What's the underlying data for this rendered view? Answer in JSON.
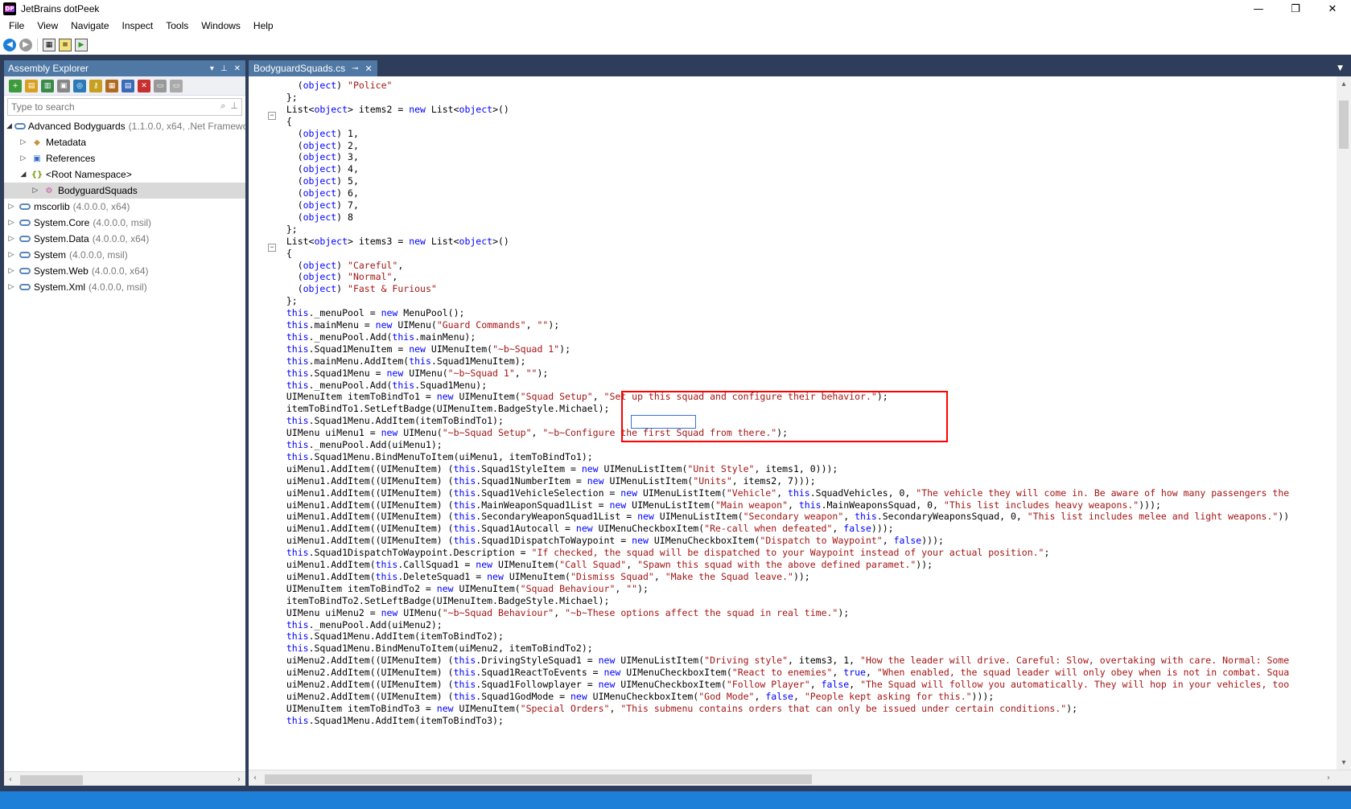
{
  "window": {
    "title": "JetBrains dotPeek",
    "logo_text": "DP",
    "minimize": "—",
    "restore": "❐",
    "close": "✕"
  },
  "menu": [
    "File",
    "View",
    "Navigate",
    "Inspect",
    "Tools",
    "Windows",
    "Help"
  ],
  "assembly_explorer": {
    "title": "Assembly Explorer",
    "search_placeholder": "Type to search",
    "tree": [
      {
        "label": "Advanced Bodyguards",
        "meta": "(1.1.0.0, x64, .Net Framewo",
        "indent": 0,
        "arrow": "◢",
        "icon": "assembly"
      },
      {
        "label": "Metadata",
        "meta": "",
        "indent": 1,
        "arrow": "▷",
        "icon": "metadata"
      },
      {
        "label": "References",
        "meta": "",
        "indent": 1,
        "arrow": "▷",
        "icon": "references"
      },
      {
        "label": "<Root Namespace>",
        "meta": "",
        "indent": 1,
        "arrow": "◢",
        "icon": "namespace"
      },
      {
        "label": "BodyguardSquads",
        "meta": "",
        "indent": 2,
        "arrow": "▷",
        "icon": "class",
        "selected": true
      },
      {
        "label": "mscorlib",
        "meta": "(4.0.0.0, x64)",
        "indent": 0,
        "arrow": "▷",
        "icon": "assembly"
      },
      {
        "label": "System.Core",
        "meta": "(4.0.0.0, msil)",
        "indent": 0,
        "arrow": "▷",
        "icon": "assembly"
      },
      {
        "label": "System.Data",
        "meta": "(4.0.0.0, x64)",
        "indent": 0,
        "arrow": "▷",
        "icon": "assembly"
      },
      {
        "label": "System",
        "meta": "(4.0.0.0, msil)",
        "indent": 0,
        "arrow": "▷",
        "icon": "assembly"
      },
      {
        "label": "System.Web",
        "meta": "(4.0.0.0, x64)",
        "indent": 0,
        "arrow": "▷",
        "icon": "assembly"
      },
      {
        "label": "System.Xml",
        "meta": "(4.0.0.0, msil)",
        "indent": 0,
        "arrow": "▷",
        "icon": "assembly"
      }
    ]
  },
  "editor": {
    "tab_label": "BodyguardSquads.cs",
    "code_lines": [
      "    (object) \"Police\"",
      "  };",
      "  List<object> items2 = new List<object>()",
      "  {",
      "    (object) 1,",
      "    (object) 2,",
      "    (object) 3,",
      "    (object) 4,",
      "    (object) 5,",
      "    (object) 6,",
      "    (object) 7,",
      "    (object) 8",
      "  };",
      "  List<object> items3 = new List<object>()",
      "  {",
      "    (object) \"Careful\",",
      "    (object) \"Normal\",",
      "    (object) \"Fast & Furious\"",
      "  };",
      "  this._menuPool = new MenuPool();",
      "  this.mainMenu = new UIMenu(\"Guard Commands\", \"\");",
      "  this._menuPool.Add(this.mainMenu);",
      "  this.Squad1MenuItem = new UIMenuItem(\"~b~Squad 1\");",
      "  this.mainMenu.AddItem(this.Squad1MenuItem);",
      "  this.Squad1Menu = new UIMenu(\"~b~Squad 1\", \"\");",
      "  this._menuPool.Add(this.Squad1Menu);",
      "  UIMenuItem itemToBindTo1 = new UIMenuItem(\"Squad Setup\", \"Set up this squad and configure their behavior.\");",
      "  itemToBindTo1.SetLeftBadge(UIMenuItem.BadgeStyle.Michael);",
      "  this.Squad1Menu.AddItem(itemToBindTo1);",
      "  UIMenu uiMenu1 = new UIMenu(\"~b~Squad Setup\", \"~b~Configure the first Squad from there.\");",
      "  this._menuPool.Add(uiMenu1);",
      "  this.Squad1Menu.BindMenuToItem(uiMenu1, itemToBindTo1);",
      "  uiMenu1.AddItem((UIMenuItem) (this.Squad1StyleItem = new UIMenuListItem(\"Unit Style\", items1, 0)));",
      "  uiMenu1.AddItem((UIMenuItem) (this.Squad1NumberItem = new UIMenuListItem(\"Units\", items2, 7)));",
      "  uiMenu1.AddItem((UIMenuItem) (this.Squad1VehicleSelection = new UIMenuListItem(\"Vehicle\", this.SquadVehicles, 0, \"The vehicle they will come in. Be aware of how many passengers the",
      "  uiMenu1.AddItem((UIMenuItem) (this.MainWeaponSquad1List = new UIMenuListItem(\"Main weapon\", this.MainWeaponsSquad, 0, \"This list includes heavy weapons.\")));",
      "  uiMenu1.AddItem((UIMenuItem) (this.SecondaryWeaponSquad1List = new UIMenuListItem(\"Secondary weapon\", this.SecondaryWeaponsSquad, 0, \"This list includes melee and light weapons.\"))",
      "  uiMenu1.AddItem((UIMenuItem) (this.Squad1Autocall = new UIMenuCheckboxItem(\"Re-call when defeated\", false)));",
      "  uiMenu1.AddItem((UIMenuItem) (this.Squad1DispatchToWaypoint = new UIMenuCheckboxItem(\"Dispatch to Waypoint\", false)));",
      "  this.Squad1DispatchToWaypoint.Description = \"If checked, the squad will be dispatched to your Waypoint instead of your actual position.\";",
      "  uiMenu1.AddItem(this.CallSquad1 = new UIMenuItem(\"Call Squad\", \"Spawn this squad with the above defined paramet.\"));",
      "  uiMenu1.AddItem(this.DeleteSquad1 = new UIMenuItem(\"Dismiss Squad\", \"Make the Squad leave.\"));",
      "  UIMenuItem itemToBindTo2 = new UIMenuItem(\"Squad Behaviour\", \"\");",
      "  itemToBindTo2.SetLeftBadge(UIMenuItem.BadgeStyle.Michael);",
      "  UIMenu uiMenu2 = new UIMenu(\"~b~Squad Behaviour\", \"~b~These options affect the squad in real time.\");",
      "  this._menuPool.Add(uiMenu2);",
      "  this.Squad1Menu.AddItem(itemToBindTo2);",
      "  this.Squad1Menu.BindMenuToItem(uiMenu2, itemToBindTo2);",
      "  uiMenu2.AddItem((UIMenuItem) (this.DrivingStyleSquad1 = new UIMenuListItem(\"Driving style\", items3, 1, \"How the leader will drive. Careful: Slow, overtaking with care. Normal: Some",
      "  uiMenu2.AddItem((UIMenuItem) (this.Squad1ReactToEvents = new UIMenuCheckboxItem(\"React to enemies\", true, \"When enabled, the squad leader will only obey when is not in combat. Squa",
      "  uiMenu2.AddItem((UIMenuItem) (this.Squad1Followplayer = new UIMenuCheckboxItem(\"Follow Player\", false, \"The Squad will follow you automatically. They will hop in your vehicles, too",
      "  uiMenu2.AddItem((UIMenuItem) (this.Squad1GodMode = new UIMenuCheckboxItem(\"God Mode\", false, \"People kept asking for this.\")));",
      "  UIMenuItem itemToBindTo3 = new UIMenuItem(\"Special Orders\", \"This submenu contains orders that can only be issued under certain conditions.\");",
      "  this.Squad1Menu.AddItem(itemToBindTo3);"
    ]
  },
  "colors": {
    "keyword": "#0000ff",
    "string": "#a31515",
    "frame": "#2d3d5a",
    "panel_header": "#4f78a4",
    "statusbar": "#1e7fd8",
    "highlight_box": "#ff0000"
  }
}
